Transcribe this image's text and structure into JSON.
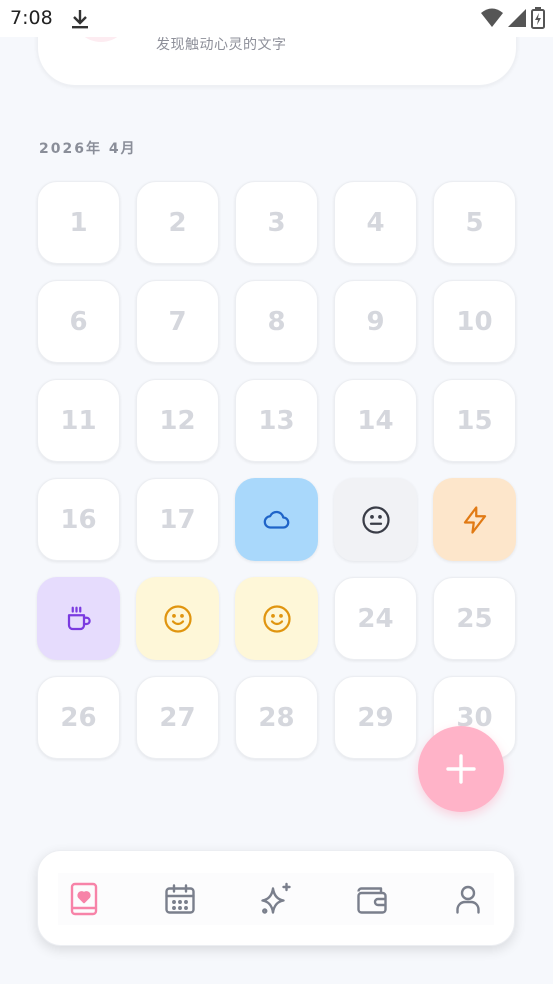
{
  "status_bar": {
    "time": "7:08",
    "icons": [
      "download-icon",
      "wifi-icon",
      "signal-icon",
      "battery-icon"
    ]
  },
  "header": {
    "subtitle": "发现触动心灵的文字"
  },
  "calendar": {
    "month_label": "2026年 4月",
    "days": [
      {
        "label": "1"
      },
      {
        "label": "2"
      },
      {
        "label": "3"
      },
      {
        "label": "4"
      },
      {
        "label": "5"
      },
      {
        "label": "6"
      },
      {
        "label": "7"
      },
      {
        "label": "8"
      },
      {
        "label": "9"
      },
      {
        "label": "10"
      },
      {
        "label": "11"
      },
      {
        "label": "12"
      },
      {
        "label": "13"
      },
      {
        "label": "14"
      },
      {
        "label": "15"
      },
      {
        "label": "16"
      },
      {
        "label": "17"
      },
      {
        "mood": "cloud-icon",
        "bg": "#a9d8fb",
        "color": "#1f64c8"
      },
      {
        "mood": "neutral-face-icon",
        "bg": "#f1f2f5",
        "color": "#3a3d47"
      },
      {
        "mood": "lightning-icon",
        "bg": "#fde6cb",
        "color": "#e17a14"
      },
      {
        "mood": "coffee-icon",
        "bg": "#e6dcfd",
        "color": "#7b3be0"
      },
      {
        "mood": "smile-icon",
        "bg": "#fef7d8",
        "color": "#e0950f"
      },
      {
        "mood": "smile-icon",
        "bg": "#fef7d8",
        "color": "#e0950f"
      },
      {
        "label": "24"
      },
      {
        "label": "25"
      },
      {
        "label": "26"
      },
      {
        "label": "27"
      },
      {
        "label": "28"
      },
      {
        "label": "29"
      },
      {
        "label": "30"
      }
    ]
  },
  "nav": {
    "items": [
      {
        "name": "nav-diary",
        "icon": "heart-book-icon",
        "active": true
      },
      {
        "name": "nav-calendar",
        "icon": "calendar-icon",
        "active": false
      },
      {
        "name": "nav-discover",
        "icon": "sparkles-icon",
        "active": false
      },
      {
        "name": "nav-wallet",
        "icon": "wallet-icon",
        "active": false
      },
      {
        "name": "nav-profile",
        "icon": "user-icon",
        "active": false
      }
    ]
  },
  "colors": {
    "accent": "#ffb3c8",
    "active_nav": "#f783a8",
    "inactive_nav": "#7a7f8c",
    "day_text": "#d5d7dd",
    "background": "#f6f8fc"
  }
}
